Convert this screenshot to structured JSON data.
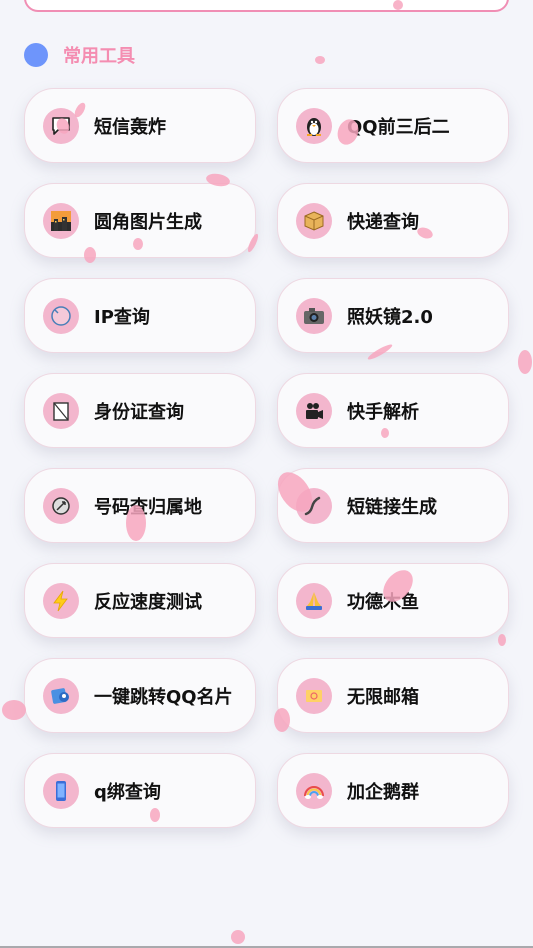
{
  "section": {
    "title": "常用工具",
    "dot_color": "#6e95fb",
    "title_color": "#f48db1"
  },
  "tools": [
    {
      "label": "短信轰炸",
      "icon": "message-icon"
    },
    {
      "label": "QQ前三后二",
      "icon": "penguin-icon"
    },
    {
      "label": "圆角图片生成",
      "icon": "image-icon"
    },
    {
      "label": "快递查询",
      "icon": "package-icon"
    },
    {
      "label": "IP查询",
      "icon": "globe-icon"
    },
    {
      "label": "照妖镜2.0",
      "icon": "camera-icon"
    },
    {
      "label": "身份证查询",
      "icon": "id-card-icon"
    },
    {
      "label": "快手解析",
      "icon": "video-camera-icon"
    },
    {
      "label": "号码查归属地",
      "icon": "satellite-dish-icon"
    },
    {
      "label": "短链接生成",
      "icon": "link-icon"
    },
    {
      "label": "反应速度测试",
      "icon": "lightning-icon"
    },
    {
      "label": "功德木鱼",
      "icon": "praying-hands-icon"
    },
    {
      "label": "一键跳转QQ名片",
      "icon": "contact-card-icon"
    },
    {
      "label": "无限邮箱",
      "icon": "mailbox-icon"
    },
    {
      "label": "q绑查询",
      "icon": "phone-icon"
    },
    {
      "label": "加企鹅群",
      "icon": "rainbow-icon"
    }
  ]
}
